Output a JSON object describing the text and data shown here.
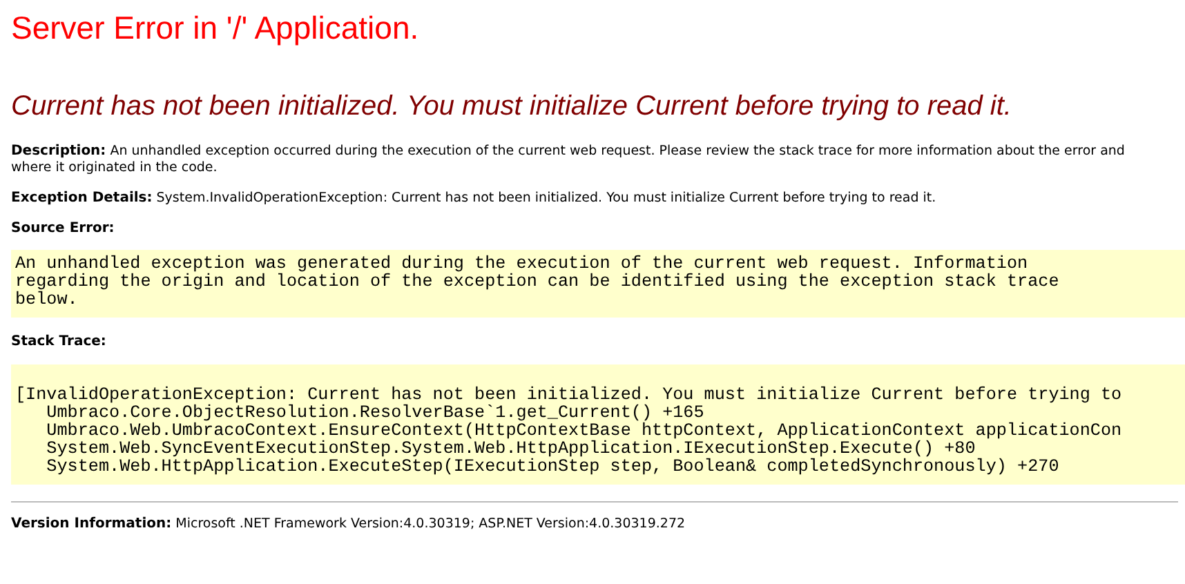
{
  "title": "Server Error in '/' Application.",
  "message": "Current has not been initialized. You must initialize Current before trying to read it.",
  "description": {
    "label": "Description:",
    "text": "An unhandled exception occurred during the execution of the current web request. Please review the stack trace for more information about the error and where it originated in the code."
  },
  "exception_details": {
    "label": "Exception Details:",
    "text": "System.InvalidOperationException: Current has not been initialized. You must initialize Current before trying to read it."
  },
  "source_error": {
    "label": "Source Error:",
    "lines": [
      "An unhandled exception was generated during the execution of the current web request. Information",
      "regarding the origin and location of the exception can be identified using the exception stack trace",
      "below."
    ]
  },
  "stack_trace": {
    "label": "Stack Trace:",
    "lines": [
      "[InvalidOperationException: Current has not been initialized. You must initialize Current before trying to",
      "   Umbraco.Core.ObjectResolution.ResolverBase`1.get_Current() +165",
      "   Umbraco.Web.UmbracoContext.EnsureContext(HttpContextBase httpContext, ApplicationContext applicationCon",
      "   System.Web.SyncEventExecutionStep.System.Web.HttpApplication.IExecutionStep.Execute() +80",
      "   System.Web.HttpApplication.ExecuteStep(IExecutionStep step, Boolean& completedSynchronously) +270"
    ]
  },
  "version": {
    "label": "Version Information:",
    "text": "Microsoft .NET Framework Version:4.0.30319; ASP.NET Version:4.0.30319.272"
  }
}
